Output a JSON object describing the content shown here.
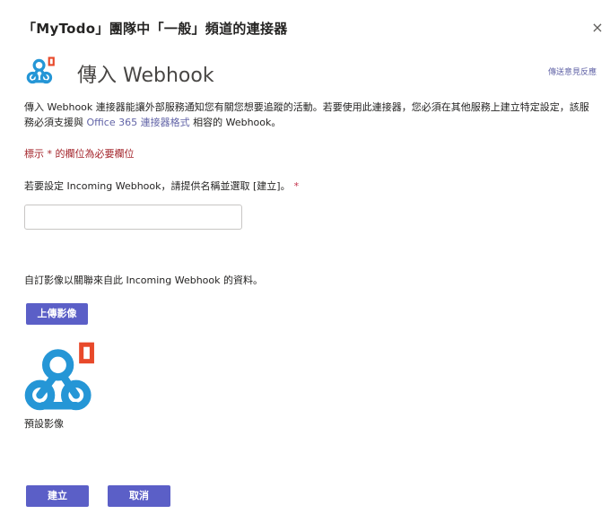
{
  "dialog": {
    "title": "「MyTodo」團隊中「一般」頻道的連接器",
    "close_glyph": "×"
  },
  "connector": {
    "name": "傳入 Webhook",
    "feedback_link": "傳送意見反應",
    "logo_icon": "webhook-icon",
    "office_badge_icon": "office-icon"
  },
  "description": {
    "part1": "傳入 Webhook 連接器能讓外部服務通知您有關您想要追蹤的活動。若要使用此連接器，您必須在其他服務上建立特定設定，該服務必須支援與 ",
    "link": "Office 365 連接器格式",
    "part2": " 相容的 Webhook。"
  },
  "required_note": "標示 * 的欄位為必要欄位",
  "name_field": {
    "label": "若要設定 Incoming Webhook，請提供名稱並選取 [建立]。",
    "asterisk": "*",
    "value": "",
    "placeholder": ""
  },
  "image_section": {
    "label": "自訂影像以關聯來自此 Incoming Webhook 的資料。",
    "upload_label": "上傳影像",
    "preview_caption": "預設影像"
  },
  "actions": {
    "create_label": "建立",
    "cancel_label": "取消"
  },
  "colors": {
    "accent": "#5b5fc7",
    "link": "#6264a7",
    "required": "#a4262c",
    "webhook_blue": "#2596d6",
    "office_red": "#e8492a"
  }
}
